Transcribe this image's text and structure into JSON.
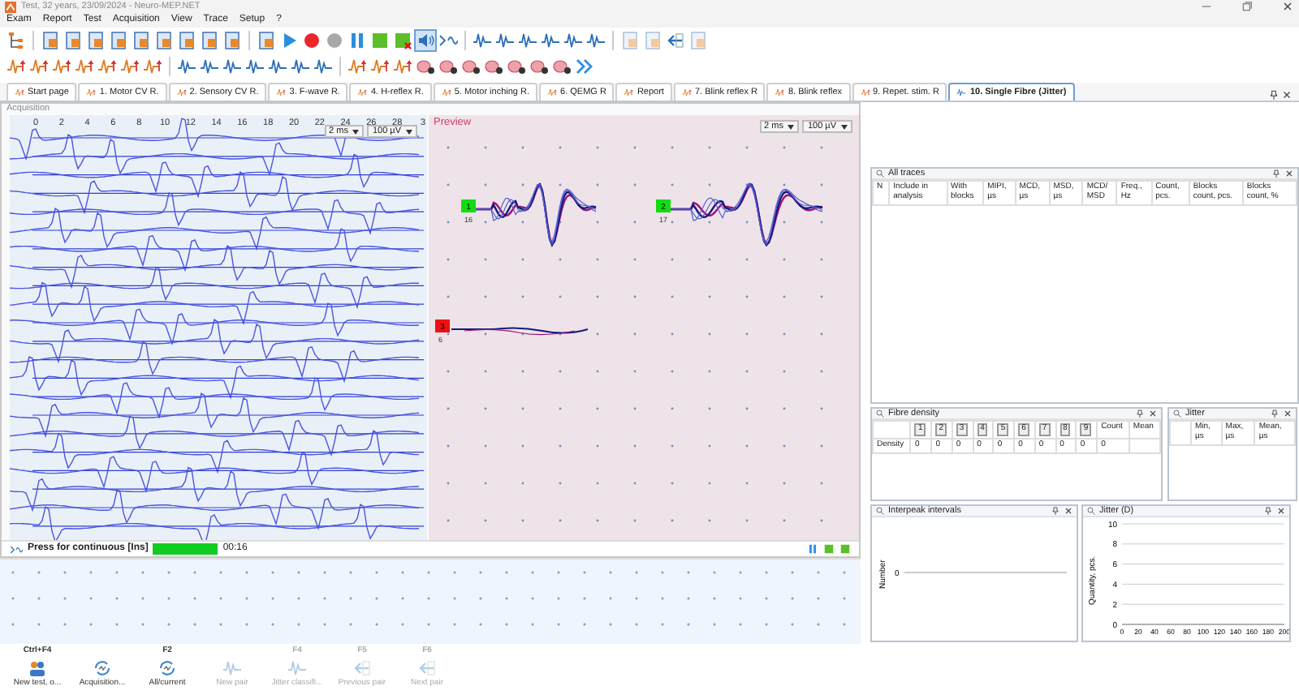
{
  "window": {
    "title": "Test, 32 years, 23/09/2024 - Neuro-MEP.NET"
  },
  "menu": [
    "Exam",
    "Report",
    "Test",
    "Acquisition",
    "View",
    "Trace",
    "Setup",
    "?"
  ],
  "tabs": [
    {
      "label": "Start page",
      "selected": false
    },
    {
      "label": "1. Motor CV R.",
      "selected": false
    },
    {
      "label": "2. Sensory CV R.",
      "selected": false
    },
    {
      "label": "3. F-wave R.",
      "selected": false
    },
    {
      "label": "4. H-reflex R.",
      "selected": false
    },
    {
      "label": "5. Motor inching R.",
      "selected": false
    },
    {
      "label": "6. QEMG R",
      "selected": false
    },
    {
      "label": "Report",
      "selected": false
    },
    {
      "label": "7. Blink reflex R",
      "selected": false
    },
    {
      "label": "8. Blink reflex",
      "selected": false
    },
    {
      "label": "9. Repet. stim. R",
      "selected": false
    },
    {
      "label": "10. Single Fibre (Jitter)",
      "selected": true
    }
  ],
  "acquisition": {
    "title": "Acquisition",
    "time_ticks": [
      "0",
      "2",
      "4",
      "6",
      "8",
      "10",
      "12",
      "14",
      "16",
      "18",
      "20",
      "22",
      "24",
      "26",
      "28",
      "3"
    ],
    "timebase": "2 ms",
    "sensitivity": "100 µV",
    "status": {
      "label": "Press for continuous [Ins]",
      "level": 1,
      "time": "00:16"
    }
  },
  "preview": {
    "title": "Preview",
    "timebase": "2 ms",
    "sensitivity": "100 µV",
    "markers": [
      {
        "label": "1",
        "number": "16",
        "color": "#11dd11"
      },
      {
        "label": "2",
        "number": "17",
        "color": "#11dd11"
      },
      {
        "label": "3",
        "number": "6",
        "color": "#ee1111"
      }
    ]
  },
  "all_traces": {
    "title": "All traces",
    "columns": [
      "N",
      "Include in analysis",
      "With blocks",
      "MIPI, µs",
      "MCD, µs",
      "MSD, µs",
      "MCD/ MSD",
      "Freq., Hz",
      "Count, pcs.",
      "Blocks count, pcs.",
      "Blocks count, %"
    ]
  },
  "fibre_density": {
    "title": "Fibre density",
    "columns": [
      "1",
      "2",
      "3",
      "4",
      "5",
      "6",
      "7",
      "8",
      "9",
      "Count",
      "Mean"
    ],
    "rows": [
      {
        "label": "Density",
        "cells": [
          "0",
          "0",
          "0",
          "0",
          "0",
          "0",
          "0",
          "0",
          "0",
          "0"
        ]
      }
    ]
  },
  "jitter": {
    "title": "Jitter",
    "columns": [
      "Min, µs",
      "Max, µs",
      "Mean, µs"
    ]
  },
  "interpeak_intervals": {
    "title": "Interpeak intervals",
    "ylabel": "Number",
    "ytick": "0"
  },
  "jitter_chart": {
    "title": "Jitter (D)",
    "chart_data": {
      "type": "bar",
      "ylabel": "Quantity, pcs.",
      "ylim": [
        0,
        10
      ],
      "yticks": [
        0,
        2,
        4,
        6,
        8,
        10
      ],
      "xlim": [
        0,
        200
      ],
      "xticks": [
        0,
        20,
        40,
        60,
        80,
        100,
        120,
        140,
        160,
        180,
        200
      ],
      "grid": true
    }
  },
  "bottom_toolbar": [
    {
      "shortcut": "Ctrl+F4",
      "label": "New test, o...",
      "disabled": false
    },
    {
      "label": "Acquisition...",
      "disabled": false
    },
    {
      "shortcut": "F2",
      "label": "All/current",
      "disabled": false
    },
    {
      "label": "New pair",
      "disabled": true
    },
    {
      "shortcut": "F4",
      "label": "Jitter classifi...",
      "disabled": true
    },
    {
      "shortcut": "F5",
      "label": "Previous pair",
      "disabled": true
    },
    {
      "shortcut": "F6",
      "label": "Next pair",
      "disabled": true
    }
  ]
}
